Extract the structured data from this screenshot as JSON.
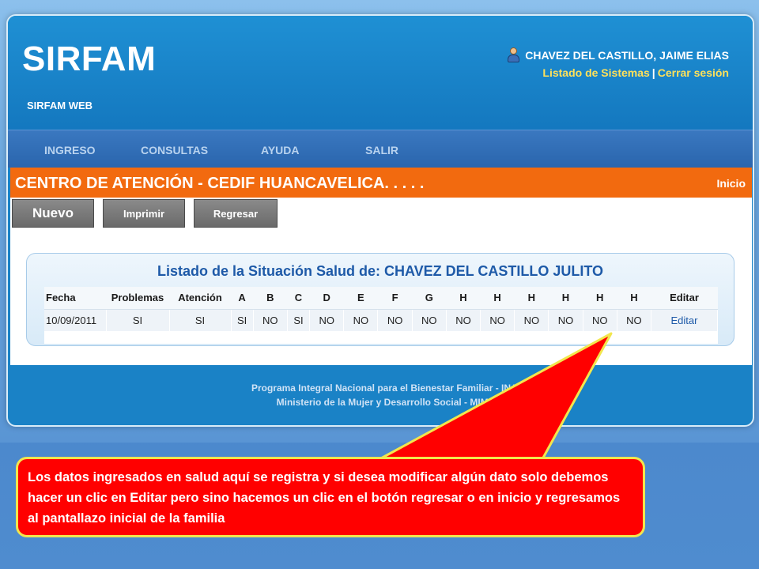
{
  "app": {
    "logo": "SIRFAM",
    "subtitle": "SIRFAM WEB",
    "user": {
      "name": "CHAVEZ DEL CASTILLO, JAIME ELIAS",
      "links": [
        "Listado de Sistemas",
        "Cerrar sesión"
      ],
      "separator": "|"
    }
  },
  "nav": {
    "items": [
      "INGRESO",
      "CONSULTAS",
      "AYUDA",
      "SALIR"
    ]
  },
  "center": {
    "title": "CENTRO DE ATENCIÓN - CEDIF HUANCAVELICA. . . . .",
    "home_link": "Inicio"
  },
  "toolbar": {
    "new_label": "Nuevo",
    "print_label": "Imprimir",
    "back_label": "Regresar"
  },
  "panel": {
    "title": "Listado de la Situación Salud de: CHAVEZ DEL CASTILLO JULITO"
  },
  "table": {
    "columns": [
      "Fecha",
      "Problemas",
      "Atención",
      "A",
      "B",
      "C",
      "D",
      "E",
      "F",
      "G",
      "H",
      "H",
      "H",
      "H",
      "H",
      "H",
      "Editar"
    ],
    "rows": [
      [
        "10/09/2011",
        "SI",
        "SI",
        "SI",
        "NO",
        "SI",
        "NO",
        "NO",
        "NO",
        "NO",
        "NO",
        "NO",
        "NO",
        "NO",
        "NO",
        "NO",
        "Editar"
      ]
    ]
  },
  "footer": {
    "line1": "Programa Integral Nacional para el Bienestar Familiar - INABIF",
    "line2": "Ministerio de la Mujer y Desarrollo Social - MIMDES"
  },
  "callout": {
    "text": "Los datos ingresados en salud aquí se registra y si desea modificar algún dato solo debemos hacer un clic en Editar pero sino hacemos un clic en el botón regresar o en inicio y regresamos al pantallazo inicial de la familia",
    "fill_color": "#ff0000",
    "border_color": "#f2e64d"
  },
  "colors": {
    "accent_orange": "#f26a0f",
    "header_blue": "#1a82c6",
    "link_yellow": "#ffe15a"
  }
}
